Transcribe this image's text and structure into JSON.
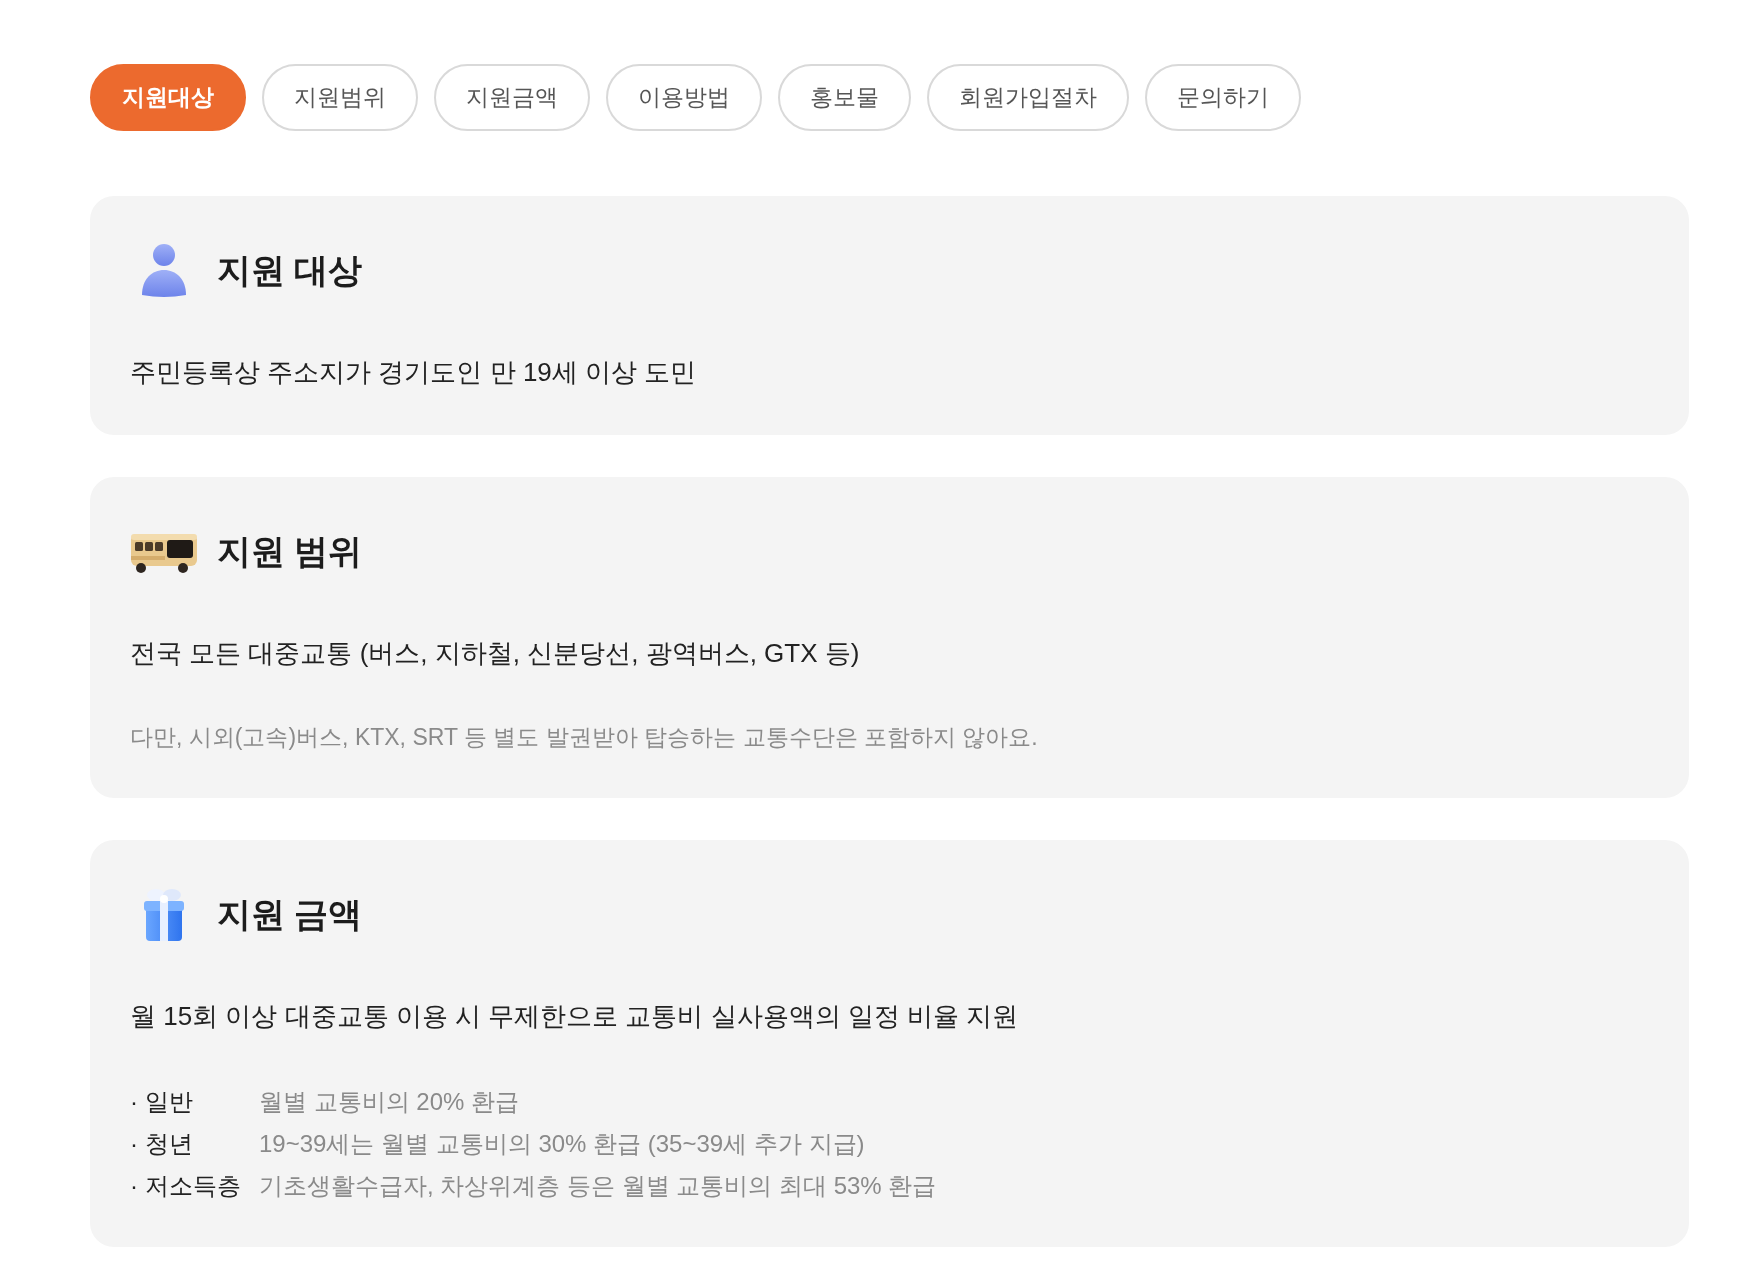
{
  "tabs": [
    {
      "label": "지원대상",
      "selected": true
    },
    {
      "label": "지원범위",
      "selected": false
    },
    {
      "label": "지원금액",
      "selected": false
    },
    {
      "label": "이용방법",
      "selected": false
    },
    {
      "label": "홍보물",
      "selected": false
    },
    {
      "label": "회원가입절차",
      "selected": false
    },
    {
      "label": "문의하기",
      "selected": false
    }
  ],
  "sections": [
    {
      "title": "지원 대상",
      "body": "주민등록상 주소지가 경기도인 만 19세 이상 도민"
    },
    {
      "title": "지원 범위",
      "body": "전국 모든 대중교통 (버스, 지하철, 신분당선, 광역버스, GTX 등)",
      "note": "다만, 시외(고속)버스, KTX, SRT 등 별도 발권받아 탑승하는 교통수단은 포함하지 않아요."
    },
    {
      "title": "지원 금액",
      "body": "월 15회 이상 대중교통 이용 시 무제한으로 교통비 실사용액의 일정 비율 지원",
      "items": [
        {
          "label": "· 일반",
          "text": "월별 교통비의 20% 환급"
        },
        {
          "label": "· 청년",
          "text": "19~39세는 월별 교통비의 30% 환급 (35~39세 추가 지급)"
        },
        {
          "label": "· 저소득층",
          "text": "기초생활수급자, 차상위계층 등은 월별 교통비의 최대 53% 환급"
        }
      ]
    }
  ]
}
